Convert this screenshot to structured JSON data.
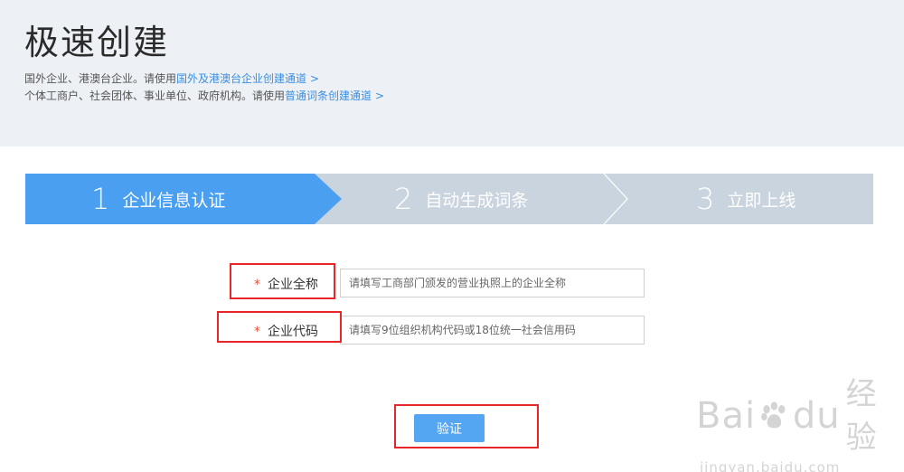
{
  "header": {
    "title": "极速创建",
    "note1_prefix": "国外企业、港澳台企业。请使用",
    "note1_link": "国外及港澳台企业创建通道",
    "note2_prefix": "个体工商户、社会团体、事业单位、政府机构。请使用",
    "note2_link": "普通词条创建通道",
    "arrow": ">"
  },
  "steps": [
    {
      "num": "1",
      "label": "企业信息认证",
      "active": true
    },
    {
      "num": "2",
      "label": "自动生成词条",
      "active": false
    },
    {
      "num": "3",
      "label": "立即上线",
      "active": false
    }
  ],
  "form": {
    "required_mark": "*",
    "company_name_label": "企业全称",
    "company_name_placeholder": "请填写工商部门颁发的营业执照上的企业全称",
    "company_code_label": "企业代码",
    "company_code_placeholder": "请填写9位组织机构代码或18位统一社会信用码",
    "verify_button": "验证"
  },
  "watermark": {
    "logo_left": "Bai",
    "logo_right": "du",
    "product": "经验",
    "url": "jingyan.baidu.com"
  },
  "colors": {
    "header_bg": "#edf0f5",
    "step_active": "#4a9ff0",
    "step_inactive": "#cad4df",
    "link": "#3a8fe0",
    "button": "#55a6f2",
    "required": "#e8503a",
    "highlight_box": "#e8262a"
  }
}
